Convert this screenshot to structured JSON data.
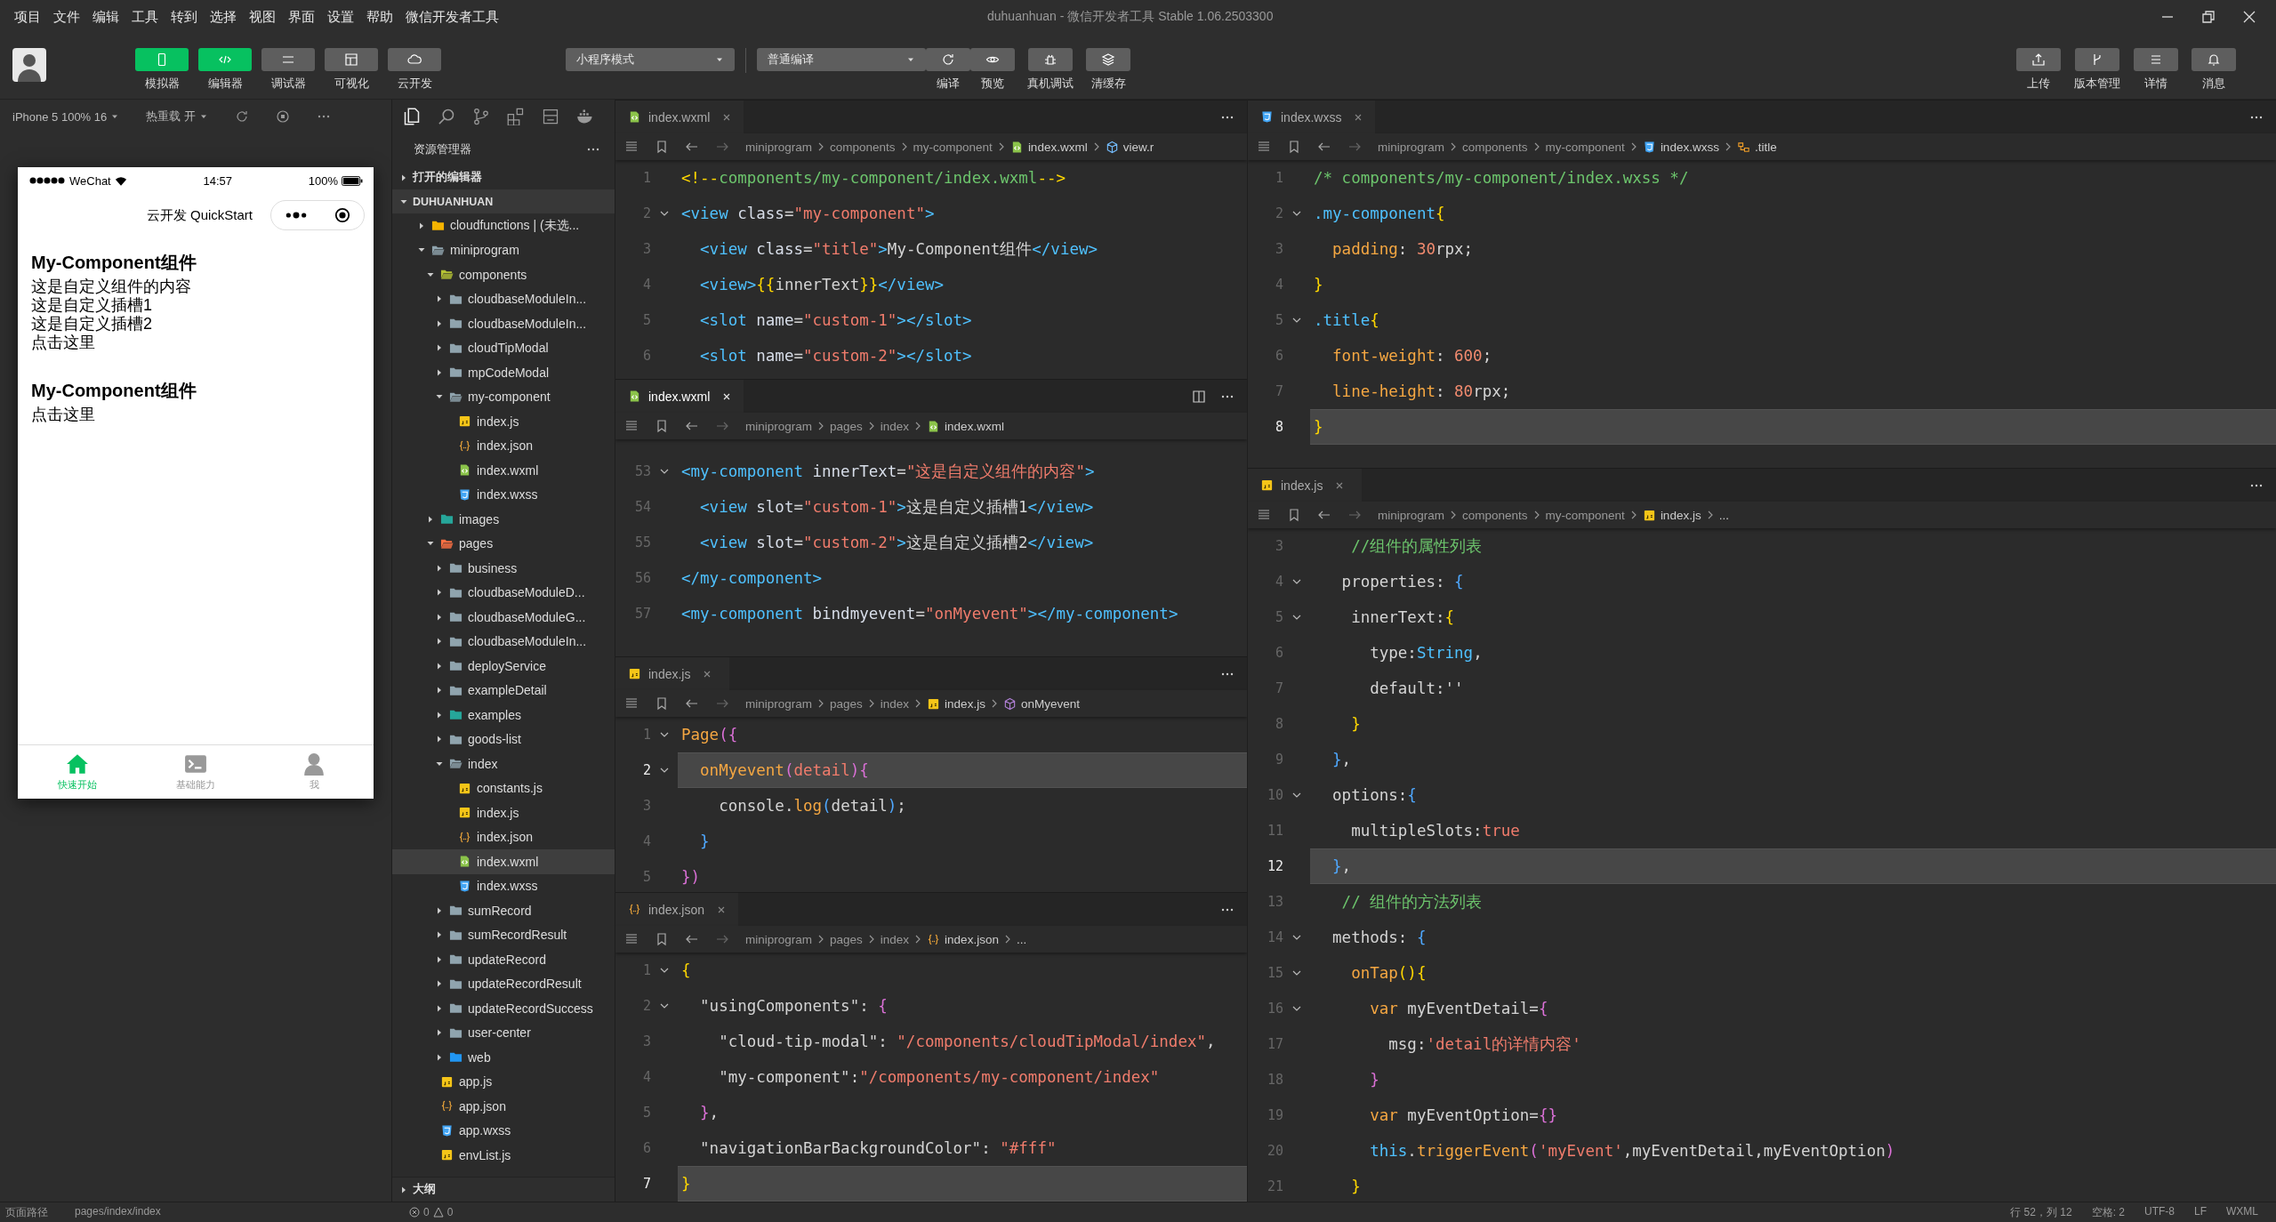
{
  "window": {
    "title": "duhuanhuan - 微信开发者工具 Stable 1.06.2503300"
  },
  "menu": [
    "项目",
    "文件",
    "编辑",
    "工具",
    "转到",
    "选择",
    "视图",
    "界面",
    "设置",
    "帮助",
    "微信开发者工具"
  ],
  "toolbar": {
    "modes": [
      {
        "label": "模拟器",
        "selected": true
      },
      {
        "label": "编辑器",
        "selected": true
      },
      {
        "label": "调试器",
        "selected": false
      },
      {
        "label": "可视化",
        "selected": false
      },
      {
        "label": "云开发",
        "selected": false
      }
    ],
    "mode_select": "小程序模式",
    "compile_select": "普通编译",
    "actions": [
      "编译",
      "预览",
      "真机调试",
      "清缓存"
    ],
    "right_actions": [
      "上传",
      "版本管理",
      "详情",
      "消息"
    ]
  },
  "simulator": {
    "device": "iPhone 5 100% 16",
    "hot_reload": "热重载 开",
    "phone": {
      "carrier": "WeChat",
      "time": "14:57",
      "battery": "100%",
      "nav_title": "云开发 QuickStart",
      "blocks": [
        {
          "heading": "My-Component组件",
          "lines": [
            "这是自定义组件的内容",
            "这是自定义插槽1",
            "这是自定义插槽2",
            "点击这里"
          ]
        },
        {
          "heading": "My-Component组件",
          "lines": [
            "点击这里"
          ]
        }
      ],
      "tabbar": [
        {
          "label": "快速开始",
          "selected": true
        },
        {
          "label": "基础能力",
          "selected": false
        },
        {
          "label": "我",
          "selected": false
        }
      ]
    }
  },
  "explorer": {
    "title": "资源管理器",
    "sections": [
      {
        "label": "打开的编辑器",
        "expanded": false
      },
      {
        "label": "DUHUANHUAN",
        "expanded": true
      }
    ],
    "tree": [
      {
        "label": "cloudfunctions | (未选...",
        "kind": "folder",
        "color": "#f5b400",
        "expanded": false,
        "selected": false
      },
      {
        "label": "miniprogram",
        "kind": "folder",
        "expanded": true,
        "selected": false,
        "children": [
          {
            "label": "components",
            "kind": "folder",
            "color": "#b5c334",
            "expanded": true,
            "selected": false,
            "children": [
              {
                "label": "cloudbaseModuleIn...",
                "kind": "folder",
                "expanded": false,
                "selected": false
              },
              {
                "label": "cloudbaseModuleIn...",
                "kind": "folder",
                "expanded": false,
                "selected": false
              },
              {
                "label": "cloudTipModal",
                "kind": "folder",
                "expanded": false,
                "selected": false
              },
              {
                "label": "mpCodeModal",
                "kind": "folder",
                "expanded": false,
                "selected": false
              },
              {
                "label": "my-component",
                "kind": "folder",
                "expanded": true,
                "selected": false,
                "children": [
                  {
                    "label": "index.js",
                    "kind": "js",
                    "selected": false
                  },
                  {
                    "label": "index.json",
                    "kind": "json",
                    "selected": false
                  },
                  {
                    "label": "index.wxml",
                    "kind": "wxml",
                    "selected": false
                  },
                  {
                    "label": "index.wxss",
                    "kind": "wxss",
                    "selected": false
                  }
                ]
              }
            ]
          },
          {
            "label": "images",
            "kind": "folder",
            "color": "#26a69a",
            "expanded": false,
            "selected": false
          },
          {
            "label": "pages",
            "kind": "folder",
            "color": "#ff7043",
            "expanded": true,
            "selected": false,
            "children": [
              {
                "label": "business",
                "kind": "folder",
                "expanded": false,
                "selected": false
              },
              {
                "label": "cloudbaseModuleD...",
                "kind": "folder",
                "expanded": false,
                "selected": false
              },
              {
                "label": "cloudbaseModuleG...",
                "kind": "folder",
                "expanded": false,
                "selected": false
              },
              {
                "label": "cloudbaseModuleIn...",
                "kind": "folder",
                "expanded": false,
                "selected": false
              },
              {
                "label": "deployService",
                "kind": "folder",
                "expanded": false,
                "selected": false
              },
              {
                "label": "exampleDetail",
                "kind": "folder",
                "expanded": false,
                "selected": false
              },
              {
                "label": "examples",
                "kind": "folder",
                "color": "#26a69a",
                "expanded": false,
                "selected": false
              },
              {
                "label": "goods-list",
                "kind": "folder",
                "expanded": false,
                "selected": false
              },
              {
                "label": "index",
                "kind": "folder",
                "expanded": true,
                "selected": false,
                "children": [
                  {
                    "label": "constants.js",
                    "kind": "js",
                    "selected": false
                  },
                  {
                    "label": "index.js",
                    "kind": "js",
                    "selected": false
                  },
                  {
                    "label": "index.json",
                    "kind": "json",
                    "selected": false
                  },
                  {
                    "label": "index.wxml",
                    "kind": "wxml",
                    "selected": true
                  },
                  {
                    "label": "index.wxss",
                    "kind": "wxss",
                    "selected": false
                  }
                ]
              },
              {
                "label": "sumRecord",
                "kind": "folder",
                "expanded": false,
                "selected": false
              },
              {
                "label": "sumRecordResult",
                "kind": "folder",
                "expanded": false,
                "selected": false
              },
              {
                "label": "updateRecord",
                "kind": "folder",
                "expanded": false,
                "selected": false
              },
              {
                "label": "updateRecordResult",
                "kind": "folder",
                "expanded": false,
                "selected": false
              },
              {
                "label": "updateRecordSuccess",
                "kind": "folder",
                "expanded": false,
                "selected": false
              },
              {
                "label": "user-center",
                "kind": "folder",
                "expanded": false,
                "selected": false
              },
              {
                "label": "web",
                "kind": "folder",
                "color": "#2196f3",
                "expanded": false,
                "selected": false
              }
            ]
          },
          {
            "label": "app.js",
            "kind": "js",
            "selected": false
          },
          {
            "label": "app.json",
            "kind": "json",
            "selected": false
          },
          {
            "label": "app.wxss",
            "kind": "wxss",
            "selected": false
          },
          {
            "label": "envList.js",
            "kind": "js",
            "selected": false
          }
        ]
      }
    ],
    "outline": {
      "label": "大纲",
      "expanded": false
    }
  },
  "editors": {
    "middle": [
      {
        "tab": {
          "label": "index.wxml",
          "kind": "wxml"
        },
        "focused": false,
        "breadcrumb": [
          {
            "text": "miniprogram",
            "kind": "dir"
          },
          {
            "text": "components",
            "kind": "dir"
          },
          {
            "text": "my-component",
            "kind": "dir"
          },
          {
            "text": "index.wxml",
            "kind": "wxml"
          },
          {
            "text": "view.r",
            "kind": "element"
          }
        ],
        "lines": [
          {
            "number": "1",
            "fold": false,
            "current": false,
            "segments": [
              {
                "kind": "delim",
                "text": "<!--"
              },
              {
                "kind": "cm",
                "text": "components/my-component/index.wxml"
              },
              {
                "kind": "delim",
                "text": "-->"
              }
            ]
          },
          {
            "number": "2",
            "fold": true,
            "current": false,
            "segments": [
              {
                "kind": "tag",
                "text": "<view"
              },
              {
                "kind": "attr",
                "text": " class"
              },
              {
                "kind": "p",
                "text": "="
              },
              {
                "kind": "str",
                "text": "\"my-component\""
              },
              {
                "kind": "tag",
                "text": ">"
              }
            ]
          },
          {
            "number": "3",
            "fold": false,
            "current": false,
            "segments": [
              {
                "kind": "tag",
                "text": "  <view"
              },
              {
                "kind": "attr",
                "text": " class"
              },
              {
                "kind": "p",
                "text": "="
              },
              {
                "kind": "str",
                "text": "\"title\""
              },
              {
                "kind": "tag",
                "text": ">"
              },
              {
                "kind": "p",
                "text": "My-Component组件"
              },
              {
                "kind": "tag",
                "text": "</view>"
              }
            ]
          },
          {
            "number": "4",
            "fold": false,
            "current": false,
            "segments": [
              {
                "kind": "tag",
                "text": "  <view>"
              },
              {
                "kind": "delim",
                "text": "{{"
              },
              {
                "kind": "p",
                "text": "innerText"
              },
              {
                "kind": "delim",
                "text": "}}"
              },
              {
                "kind": "tag",
                "text": "</view>"
              }
            ]
          },
          {
            "number": "5",
            "fold": false,
            "current": false,
            "segments": [
              {
                "kind": "tag",
                "text": "  <slot"
              },
              {
                "kind": "attr",
                "text": " name"
              },
              {
                "kind": "p",
                "text": "="
              },
              {
                "kind": "str",
                "text": "\"custom-1\""
              },
              {
                "kind": "tag",
                "text": "></slot>"
              }
            ]
          },
          {
            "number": "6",
            "fold": false,
            "current": false,
            "segments": [
              {
                "kind": "tag",
                "text": "  <slot"
              },
              {
                "kind": "attr",
                "text": " name"
              },
              {
                "kind": "p",
                "text": "="
              },
              {
                "kind": "str",
                "text": "\"custom-2\""
              },
              {
                "kind": "tag",
                "text": "></slot>"
              }
            ]
          }
        ]
      },
      {
        "tab": {
          "label": "index.wxml",
          "kind": "wxml"
        },
        "focused": true,
        "breadcrumb": [
          {
            "text": "miniprogram",
            "kind": "dir"
          },
          {
            "text": "pages",
            "kind": "dir"
          },
          {
            "text": "index",
            "kind": "dir"
          },
          {
            "text": "index.wxml",
            "kind": "wxml"
          }
        ],
        "lines": [
          {
            "number": "53",
            "fold": true,
            "current": false,
            "segments": [
              {
                "kind": "tag",
                "text": "<my-component"
              },
              {
                "kind": "attr",
                "text": " innerText"
              },
              {
                "kind": "p",
                "text": "="
              },
              {
                "kind": "str",
                "text": "\"这是自定义组件的内容\""
              },
              {
                "kind": "tag",
                "text": ">"
              }
            ]
          },
          {
            "number": "54",
            "fold": false,
            "current": false,
            "segments": [
              {
                "kind": "tag",
                "text": "  <view"
              },
              {
                "kind": "attr",
                "text": " slot"
              },
              {
                "kind": "p",
                "text": "="
              },
              {
                "kind": "str",
                "text": "\"custom-1\""
              },
              {
                "kind": "tag",
                "text": ">"
              },
              {
                "kind": "p",
                "text": "这是自定义插槽1"
              },
              {
                "kind": "tag",
                "text": "</view>"
              }
            ]
          },
          {
            "number": "55",
            "fold": false,
            "current": false,
            "segments": [
              {
                "kind": "tag",
                "text": "  <view"
              },
              {
                "kind": "attr",
                "text": " slot"
              },
              {
                "kind": "p",
                "text": "="
              },
              {
                "kind": "str",
                "text": "\"custom-2\""
              },
              {
                "kind": "tag",
                "text": ">"
              },
              {
                "kind": "p",
                "text": "这是自定义插槽2"
              },
              {
                "kind": "tag",
                "text": "</view>"
              }
            ]
          },
          {
            "number": "56",
            "fold": false,
            "current": false,
            "segments": [
              {
                "kind": "tag",
                "text": "</my-component>"
              }
            ]
          },
          {
            "number": "57",
            "fold": false,
            "current": false,
            "segments": [
              {
                "kind": "tag",
                "text": "<my-component"
              },
              {
                "kind": "attr",
                "text": " bindmyevent"
              },
              {
                "kind": "p",
                "text": "="
              },
              {
                "kind": "str",
                "text": "\"onMyevent\""
              },
              {
                "kind": "tag",
                "text": "></my-component>"
              }
            ]
          }
        ]
      },
      {
        "tab": {
          "label": "index.js",
          "kind": "js"
        },
        "focused": false,
        "breadcrumb": [
          {
            "text": "miniprogram",
            "kind": "dir"
          },
          {
            "text": "pages",
            "kind": "dir"
          },
          {
            "text": "index",
            "kind": "dir"
          },
          {
            "text": "index.js",
            "kind": "js"
          },
          {
            "text": "onMyevent",
            "kind": "method"
          }
        ],
        "lines": [
          {
            "number": "1",
            "fold": true,
            "current": false,
            "segments": [
              {
                "kind": "fn",
                "text": "Page"
              },
              {
                "kind": "br2",
                "text": "({"
              }
            ]
          },
          {
            "number": "2",
            "fold": true,
            "current": true,
            "segments": [
              {
                "kind": "fn",
                "text": "  onMyevent"
              },
              {
                "kind": "br2",
                "text": "("
              },
              {
                "kind": "str",
                "text": "detail"
              },
              {
                "kind": "br2",
                "text": "){"
              }
            ]
          },
          {
            "number": "3",
            "fold": false,
            "current": false,
            "segments": [
              {
                "kind": "p",
                "text": "    console."
              },
              {
                "kind": "fn",
                "text": "log"
              },
              {
                "kind": "br3",
                "text": "("
              },
              {
                "kind": "p",
                "text": "detail"
              },
              {
                "kind": "br3",
                "text": ")"
              },
              {
                "kind": "p",
                "text": ";"
              }
            ]
          },
          {
            "number": "4",
            "fold": false,
            "current": false,
            "segments": [
              {
                "kind": "br3",
                "text": "  }"
              }
            ]
          },
          {
            "number": "5",
            "fold": false,
            "current": false,
            "segments": [
              {
                "kind": "br2",
                "text": "})"
              }
            ]
          }
        ]
      },
      {
        "tab": {
          "label": "index.json",
          "kind": "json"
        },
        "focused": false,
        "breadcrumb": [
          {
            "text": "miniprogram",
            "kind": "dir"
          },
          {
            "text": "pages",
            "kind": "dir"
          },
          {
            "text": "index",
            "kind": "dir"
          },
          {
            "text": "index.json",
            "kind": "json"
          },
          {
            "text": "...",
            "kind": "more"
          }
        ],
        "lines": [
          {
            "number": "1",
            "fold": true,
            "current": false,
            "segments": [
              {
                "kind": "delim",
                "text": "{"
              }
            ]
          },
          {
            "number": "2",
            "fold": true,
            "current": false,
            "segments": [
              {
                "kind": "p",
                "text": "  \"usingComponents\": "
              },
              {
                "kind": "br2",
                "text": "{"
              }
            ]
          },
          {
            "number": "3",
            "fold": false,
            "current": false,
            "segments": [
              {
                "kind": "p",
                "text": "    \"cloud-tip-modal\": "
              },
              {
                "kind": "str",
                "text": "\"/components/cloudTipModal/index\""
              },
              {
                "kind": "p",
                "text": ","
              }
            ]
          },
          {
            "number": "4",
            "fold": false,
            "current": false,
            "segments": [
              {
                "kind": "p",
                "text": "    \"my-component\":"
              },
              {
                "kind": "str",
                "text": "\"/components/my-component/index\""
              }
            ]
          },
          {
            "number": "5",
            "fold": false,
            "current": false,
            "segments": [
              {
                "kind": "br2",
                "text": "  }"
              },
              {
                "kind": "p",
                "text": ","
              }
            ]
          },
          {
            "number": "6",
            "fold": false,
            "current": false,
            "segments": [
              {
                "kind": "p",
                "text": "  \"navigationBarBackgroundColor\": "
              },
              {
                "kind": "str",
                "text": "\"#fff\""
              }
            ]
          },
          {
            "number": "7",
            "fold": false,
            "current": true,
            "segments": [
              {
                "kind": "delim",
                "text": "}"
              }
            ]
          }
        ]
      }
    ],
    "right": [
      {
        "tab": {
          "label": "index.wxss",
          "kind": "wxss"
        },
        "focused": false,
        "breadcrumb": [
          {
            "text": "miniprogram",
            "kind": "dir"
          },
          {
            "text": "components",
            "kind": "dir"
          },
          {
            "text": "my-component",
            "kind": "dir"
          },
          {
            "text": "index.wxss",
            "kind": "wxss"
          },
          {
            "text": ".title",
            "kind": "selector"
          }
        ],
        "lines": [
          {
            "number": "1",
            "fold": false,
            "current": false,
            "segments": [
              {
                "kind": "cm",
                "text": "/* components/my-component/index.wxss */"
              }
            ]
          },
          {
            "number": "2",
            "fold": true,
            "current": false,
            "segments": [
              {
                "kind": "cls",
                "text": ".my-component"
              },
              {
                "kind": "delim",
                "text": "{"
              }
            ]
          },
          {
            "number": "3",
            "fold": false,
            "current": false,
            "segments": [
              {
                "kind": "prop",
                "text": "  padding"
              },
              {
                "kind": "p",
                "text": ": "
              },
              {
                "kind": "num",
                "text": "30"
              },
              {
                "kind": "p",
                "text": "rpx;"
              }
            ]
          },
          {
            "number": "4",
            "fold": false,
            "current": false,
            "segments": [
              {
                "kind": "delim",
                "text": "}"
              }
            ]
          },
          {
            "number": "5",
            "fold": true,
            "current": false,
            "segments": [
              {
                "kind": "cls",
                "text": ".title"
              },
              {
                "kind": "delim",
                "text": "{"
              }
            ]
          },
          {
            "number": "6",
            "fold": false,
            "current": false,
            "segments": [
              {
                "kind": "prop",
                "text": "  font-weight"
              },
              {
                "kind": "p",
                "text": ": "
              },
              {
                "kind": "num",
                "text": "600"
              },
              {
                "kind": "p",
                "text": ";"
              }
            ]
          },
          {
            "number": "7",
            "fold": false,
            "current": false,
            "segments": [
              {
                "kind": "prop",
                "text": "  line-height"
              },
              {
                "kind": "p",
                "text": ": "
              },
              {
                "kind": "num",
                "text": "80"
              },
              {
                "kind": "p",
                "text": "rpx;"
              }
            ]
          },
          {
            "number": "8",
            "fold": false,
            "current": true,
            "segments": [
              {
                "kind": "delim",
                "text": "}"
              }
            ]
          }
        ]
      },
      {
        "tab": {
          "label": "index.js",
          "kind": "js"
        },
        "focused": false,
        "breadcrumb": [
          {
            "text": "miniprogram",
            "kind": "dir"
          },
          {
            "text": "components",
            "kind": "dir"
          },
          {
            "text": "my-component",
            "kind": "dir"
          },
          {
            "text": "index.js",
            "kind": "js"
          },
          {
            "text": "...",
            "kind": "more"
          }
        ],
        "lines": [
          {
            "number": "3",
            "fold": false,
            "current": false,
            "segments": [
              {
                "kind": "cm",
                "text": "    //组件的属性列表"
              }
            ]
          },
          {
            "number": "4",
            "fold": true,
            "current": false,
            "segments": [
              {
                "kind": "p",
                "text": "   properties: "
              },
              {
                "kind": "br3",
                "text": "{"
              }
            ]
          },
          {
            "number": "5",
            "fold": true,
            "current": false,
            "segments": [
              {
                "kind": "p",
                "text": "    innerText:"
              },
              {
                "kind": "delim",
                "text": "{"
              }
            ]
          },
          {
            "number": "6",
            "fold": false,
            "current": false,
            "segments": [
              {
                "kind": "p",
                "text": "      type:"
              },
              {
                "kind": "tag",
                "text": "String"
              },
              {
                "kind": "p",
                "text": ","
              }
            ]
          },
          {
            "number": "7",
            "fold": false,
            "current": false,
            "segments": [
              {
                "kind": "p",
                "text": "      default:''"
              }
            ]
          },
          {
            "number": "8",
            "fold": false,
            "current": false,
            "segments": [
              {
                "kind": "delim",
                "text": "    }"
              }
            ]
          },
          {
            "number": "9",
            "fold": false,
            "current": false,
            "segments": [
              {
                "kind": "br3",
                "text": "  }"
              },
              {
                "kind": "p",
                "text": ","
              }
            ]
          },
          {
            "number": "10",
            "fold": true,
            "current": false,
            "segments": [
              {
                "kind": "p",
                "text": "  options:"
              },
              {
                "kind": "br3",
                "text": "{"
              }
            ]
          },
          {
            "number": "11",
            "fold": false,
            "current": false,
            "segments": [
              {
                "kind": "p",
                "text": "    multipleSlots:"
              },
              {
                "kind": "str",
                "text": "true"
              }
            ]
          },
          {
            "number": "12",
            "fold": false,
            "current": true,
            "segments": [
              {
                "kind": "br3",
                "text": "  }"
              },
              {
                "kind": "p",
                "text": ","
              }
            ]
          },
          {
            "number": "13",
            "fold": false,
            "current": false,
            "segments": [
              {
                "kind": "cm",
                "text": "   // 组件的方法列表"
              }
            ]
          },
          {
            "number": "14",
            "fold": true,
            "current": false,
            "segments": [
              {
                "kind": "p",
                "text": "  methods: "
              },
              {
                "kind": "br3",
                "text": "{"
              }
            ]
          },
          {
            "number": "15",
            "fold": true,
            "current": false,
            "segments": [
              {
                "kind": "fn",
                "text": "    onTap"
              },
              {
                "kind": "delim",
                "text": "(){"
              }
            ]
          },
          {
            "number": "16",
            "fold": true,
            "current": false,
            "segments": [
              {
                "kind": "kw",
                "text": "      var"
              },
              {
                "kind": "p",
                "text": " myEventDetail="
              },
              {
                "kind": "br2",
                "text": "{"
              }
            ]
          },
          {
            "number": "17",
            "fold": false,
            "current": false,
            "segments": [
              {
                "kind": "p",
                "text": "        msg:"
              },
              {
                "kind": "str",
                "text": "'detail的详情内容'"
              }
            ]
          },
          {
            "number": "18",
            "fold": false,
            "current": false,
            "segments": [
              {
                "kind": "br2",
                "text": "      }"
              }
            ]
          },
          {
            "number": "19",
            "fold": false,
            "current": false,
            "segments": [
              {
                "kind": "kw",
                "text": "      var"
              },
              {
                "kind": "p",
                "text": " myEventOption="
              },
              {
                "kind": "br2",
                "text": "{}"
              }
            ]
          },
          {
            "number": "20",
            "fold": false,
            "current": false,
            "segments": [
              {
                "kind": "tag",
                "text": "      this"
              },
              {
                "kind": "p",
                "text": "."
              },
              {
                "kind": "fn",
                "text": "triggerEvent"
              },
              {
                "kind": "br2",
                "text": "("
              },
              {
                "kind": "str",
                "text": "'myEvent'"
              },
              {
                "kind": "p",
                "text": ",myEventDetail,myEventOption"
              },
              {
                "kind": "br2",
                "text": ")"
              }
            ]
          },
          {
            "number": "21",
            "fold": false,
            "current": false,
            "segments": [
              {
                "kind": "delim",
                "text": "    }"
              }
            ]
          }
        ]
      }
    ]
  },
  "status_bar": {
    "page_path_label": "页面路径",
    "page_path": "pages/index/index",
    "errors": "0",
    "warnings": "0",
    "cursor": "行 52，列 12",
    "indent": "空格: 2",
    "encoding": "UTF-8",
    "eol": "LF",
    "language": "WXML"
  }
}
